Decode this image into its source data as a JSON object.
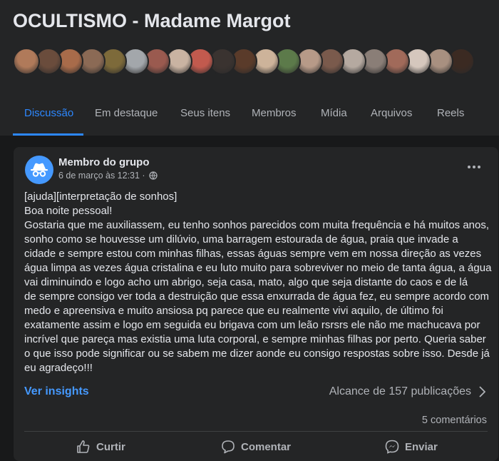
{
  "group": {
    "title": "OCULTISMO - Madame Margot"
  },
  "member_avatars": [
    {
      "color": "#b07a5a"
    },
    {
      "color": "#6a4c3c"
    },
    {
      "color": "#a86b4a"
    },
    {
      "color": "#8b6a55"
    },
    {
      "color": "#7d6a3a"
    },
    {
      "color": "#a3a7ab"
    },
    {
      "color": "#9a5a4f"
    },
    {
      "color": "#c9b3a2"
    },
    {
      "color": "#c25a4e"
    },
    {
      "color": "#3a3330"
    },
    {
      "color": "#5a3b2a"
    },
    {
      "color": "#cdb39a"
    },
    {
      "color": "#5c7a4a"
    },
    {
      "color": "#b79a88"
    },
    {
      "color": "#7a5a4c"
    },
    {
      "color": "#b5a9a0"
    },
    {
      "color": "#8a7e77"
    },
    {
      "color": "#a16a5a"
    },
    {
      "color": "#d5c7bd"
    },
    {
      "color": "#a89080"
    },
    {
      "color": "#3b2a22"
    }
  ],
  "tabs": [
    {
      "label": "Discussão"
    },
    {
      "label": "Em destaque"
    },
    {
      "label": "Seus itens"
    },
    {
      "label": "Membros"
    },
    {
      "label": "Mídia"
    },
    {
      "label": "Arquivos"
    },
    {
      "label": "Reels"
    }
  ],
  "post": {
    "author": "Membro do grupo",
    "date": "6 de março às 12:31 ·",
    "lines": [
      "[ajuda][interpretação de sonhos]",
      "Boa noite pessoal!",
      "Gostaria que me auxiliassem, eu tenho sonhos parecidos com muita frequência e há muitos anos,",
      "sonho como se houvesse um dilúvio, uma barragem estourada de água, praia que invade a",
      "cidade e sempre estou com minhas filhas, essas águas sempre vem em nossa direção as vezes",
      "água limpa as vezes água cristalina e eu luto muito para sobreviver no meio de tanta água, a água",
      "vai diminuindo e logo acho um abrigo, seja casa, mato, algo que seja distante do caos e de lá",
      "de sempre consigo ver toda a destruição que essa enxurrada de água fez, eu sempre acordo com",
      "medo e apreensiva e muito ansiosa pq parece que eu realmente vivi aquilo, de último foi",
      "exatamente assim e logo em seguida eu brigava com um leão rsrsrs ele não me machucava por",
      "incrível que pareça mas existia uma luta corporal, e sempre minhas filhas por perto. Queria saber",
      "o que isso pode significar ou se sabem me dizer aonde eu consigo respostas sobre isso. Desde já",
      "eu agradeço!!!"
    ],
    "insights_label": "Ver insights",
    "reach_label": "Alcance de 157 publicações",
    "comments_label": "5 comentários",
    "actions": {
      "like": "Curtir",
      "comment": "Comentar",
      "share": "Enviar"
    }
  }
}
